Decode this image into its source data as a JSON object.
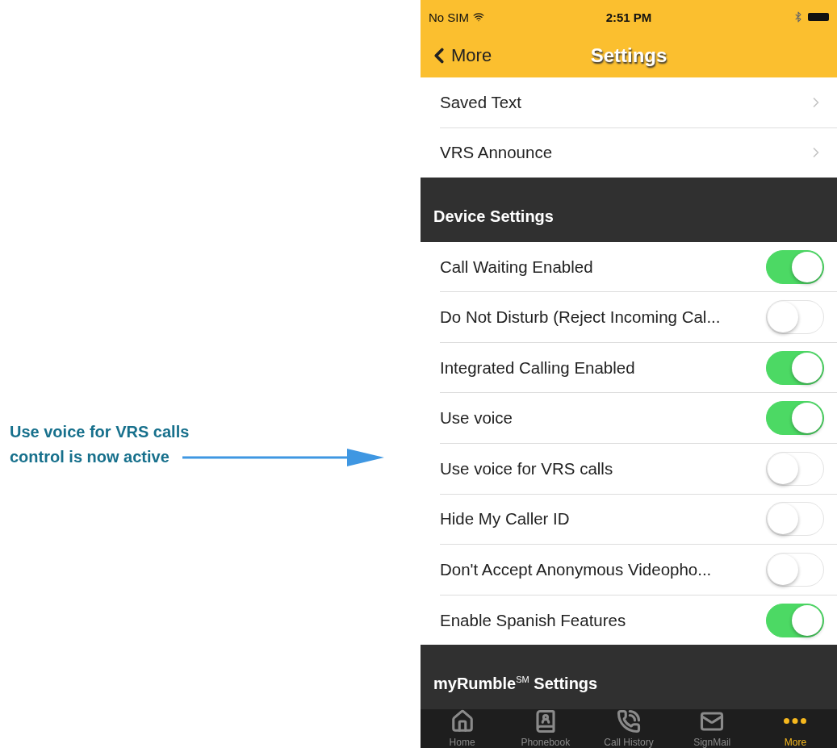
{
  "annotation": {
    "lines": [
      "Use voice for VRS calls",
      "control is now active"
    ]
  },
  "status_bar": {
    "carrier": "No SIM",
    "time": "2:51 PM"
  },
  "nav_bar": {
    "back": "More",
    "title": "Settings"
  },
  "link_rows": [
    {
      "label": "Saved Text"
    },
    {
      "label": "VRS Announce"
    }
  ],
  "sections": [
    {
      "title": "Device Settings",
      "rows": [
        {
          "label": "Call Waiting Enabled",
          "on": true
        },
        {
          "label": "Do Not Disturb (Reject Incoming Cal...",
          "on": false
        },
        {
          "label": "Integrated Calling Enabled",
          "on": true
        },
        {
          "label": "Use voice",
          "on": true
        },
        {
          "label": "Use voice for VRS calls",
          "on": false
        },
        {
          "label": "Hide My Caller ID",
          "on": false
        },
        {
          "label": "Don't Accept Anonymous Videopho...",
          "on": false
        },
        {
          "label": "Enable Spanish Features",
          "on": true
        }
      ]
    },
    {
      "title": "myRumble$^{SM}$ Settings"
    }
  ],
  "tab_bar": [
    {
      "kind": "home",
      "label": "Home",
      "selected": false
    },
    {
      "kind": "phonebook",
      "label": "Phonebook",
      "selected": false
    },
    {
      "kind": "history",
      "label": "Call History",
      "selected": false
    },
    {
      "kind": "mail",
      "label": "SignMail",
      "selected": false
    },
    {
      "kind": "more",
      "label": "More",
      "selected": true
    }
  ]
}
